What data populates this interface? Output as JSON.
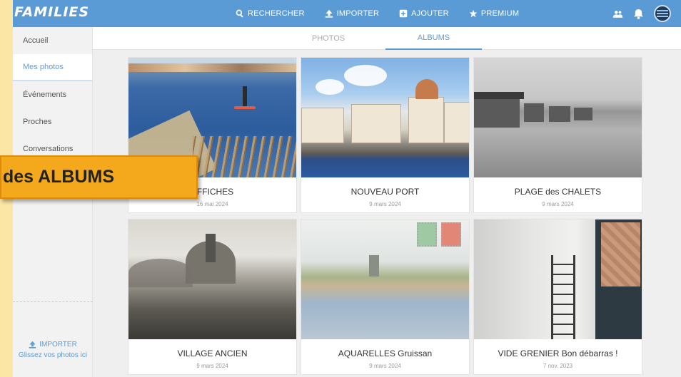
{
  "app": {
    "logo": "FAMILIES"
  },
  "topnav": {
    "search": "RECHERCHER",
    "import": "IMPORTER",
    "add": "AJOUTER",
    "premium": "PREMIUM"
  },
  "sidebar": {
    "items": [
      {
        "label": "Accueil"
      },
      {
        "label": "Mes photos"
      },
      {
        "label": "Événements"
      },
      {
        "label": "Proches"
      },
      {
        "label": "Conversations"
      }
    ],
    "import_label": "IMPORTER",
    "drop_hint": "Glissez vos photos ici"
  },
  "tabs": {
    "photos": "PHOTOS",
    "albums": "ALBUMS"
  },
  "albums": [
    {
      "title": "AFFICHES",
      "date": "16 mai 2024"
    },
    {
      "title": "NOUVEAU PORT",
      "date": "9 mars 2024"
    },
    {
      "title": "PLAGE des CHALETS",
      "date": "9 mars 2024"
    },
    {
      "title": "VILLAGE ANCIEN",
      "date": "9 mars 2024"
    },
    {
      "title": "AQUARELLES Gruissan",
      "date": "9 mars 2024"
    },
    {
      "title": "VIDE GRENIER Bon débarras !",
      "date": "7 nov. 2023"
    }
  ],
  "overlay": {
    "text": "des ALBUMS"
  },
  "colors": {
    "primary": "#5b9bd5",
    "background": "#fbe6a6",
    "overlay": "#f4a81c"
  }
}
